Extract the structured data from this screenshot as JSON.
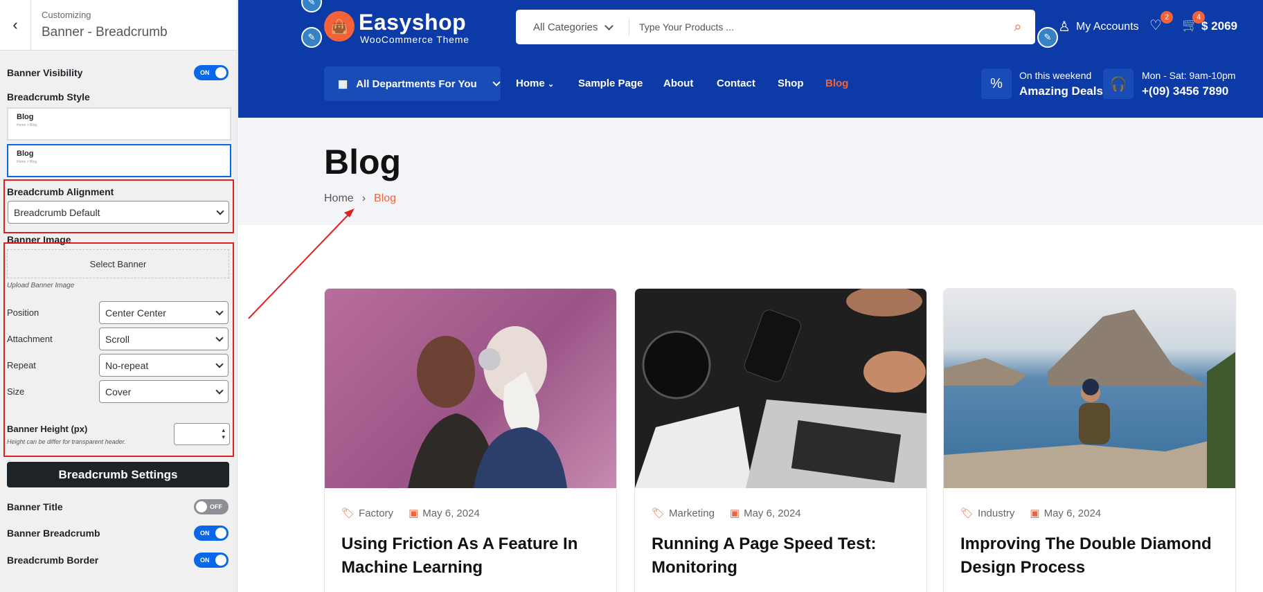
{
  "customizer": {
    "context": "Customizing",
    "title": "Banner - Breadcrumb",
    "banner_visibility": {
      "label": "Banner Visibility",
      "state": "ON"
    },
    "breadcrumb_style": {
      "label": "Breadcrumb Style",
      "options": [
        {
          "title": "Blog",
          "crumb": "Home  >  Blog"
        },
        {
          "title": "Blog",
          "crumb": "Home  >  Blog"
        }
      ]
    },
    "alignment": {
      "label": "Breadcrumb Alignment",
      "value": "Breadcrumb Default"
    },
    "banner_image": {
      "label": "Banner Image",
      "button": "Select Banner",
      "hint": "Upload Banner Image"
    },
    "position": {
      "label": "Position",
      "value": "Center Center"
    },
    "attachment": {
      "label": "Attachment",
      "value": "Scroll"
    },
    "repeat": {
      "label": "Repeat",
      "value": "No-repeat"
    },
    "size": {
      "label": "Size",
      "value": "Cover"
    },
    "height": {
      "label": "Banner Height (px)",
      "hint": "Height can be differ for transparent header."
    },
    "settings_button": "Breadcrumb Settings",
    "banner_title": {
      "label": "Banner Title",
      "state": "OFF"
    },
    "banner_breadcrumb": {
      "label": "Banner Breadcrumb",
      "state": "ON"
    },
    "breadcrumb_border": {
      "label": "Breadcrumb Border",
      "state": "ON"
    }
  },
  "site": {
    "logo": {
      "name": "Easyshop",
      "tagline": "WooCommerce Theme"
    },
    "search": {
      "category": "All Categories",
      "placeholder": "Type Your Products ..."
    },
    "account": "My Accounts",
    "wishlist_count": "2",
    "cart_count": "4",
    "cart_total": "$ 2069",
    "departments": "All Departments For You",
    "nav": [
      "Home",
      "Sample Page",
      "About",
      "Contact",
      "Shop",
      "Blog"
    ],
    "deal": {
      "small": "On this weekend",
      "big": "Amazing Deals"
    },
    "support": {
      "small": "Mon - Sat: 9am-10pm",
      "big": "+(09) 3456 7890"
    },
    "banner": {
      "title": "Blog",
      "crumb_home": "Home",
      "crumb_current": "Blog"
    },
    "posts": [
      {
        "category": "Factory",
        "date": "May 6, 2024",
        "title": "Using Friction As A Feature In Machine Learning"
      },
      {
        "category": "Marketing",
        "date": "May 6, 2024",
        "title": "Running A Page Speed Test: Monitoring"
      },
      {
        "category": "Industry",
        "date": "May 6, 2024",
        "title": "Improving The Double Diamond Design Process"
      }
    ]
  },
  "colors": {
    "brand": "#0c3aa6",
    "accent": "#f4623a",
    "toggle_on": "#0a68e8",
    "annotation": "#e02020"
  }
}
